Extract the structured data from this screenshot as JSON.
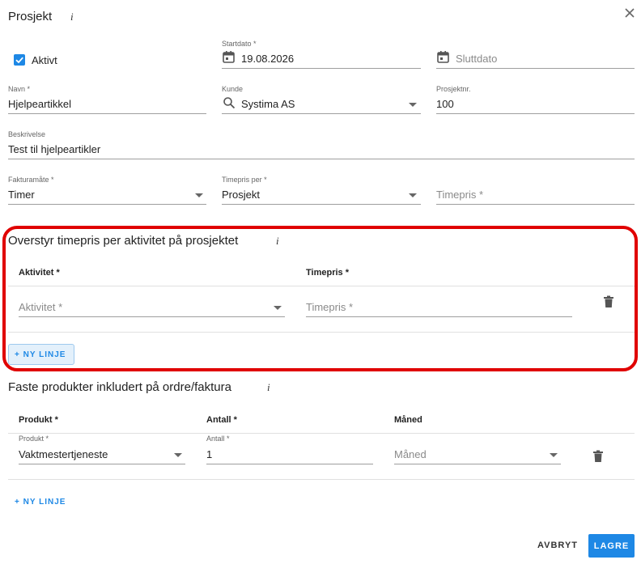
{
  "dialog": {
    "title": "Prosjekt",
    "info": "i"
  },
  "active": {
    "label": "Aktivt",
    "checked": true
  },
  "start_date": {
    "label": "Startdato *",
    "value": "19.08.2026"
  },
  "end_date": {
    "placeholder": "Sluttdato"
  },
  "name": {
    "label": "Navn *",
    "value": "Hjelpeartikkel"
  },
  "customer": {
    "label": "Kunde",
    "value": "Systima AS"
  },
  "project_no": {
    "label": "Prosjektnr.",
    "value": "100"
  },
  "description": {
    "label": "Beskrivelse",
    "value": "Test til hjelpeartikler"
  },
  "billing_method": {
    "label": "Fakturamåte *",
    "value": "Timer"
  },
  "hourly_rate_per": {
    "label": "Timepris per *",
    "value": "Prosjekt"
  },
  "hourly_rate": {
    "placeholder": "Timepris *"
  },
  "override_section": {
    "title": "Overstyr timepris per aktivitet på prosjektet",
    "info": "i",
    "columns": [
      "Aktivitet *",
      "Timepris *"
    ],
    "row": {
      "activity_placeholder": "Aktivitet *",
      "rate_placeholder": "Timepris *"
    },
    "new_line": "+ NY LINJE"
  },
  "products_section": {
    "title": "Faste produkter inkludert på ordre/faktura",
    "info": "i",
    "columns": [
      "Produkt *",
      "Antall *",
      "Måned"
    ],
    "row": {
      "product_label": "Produkt *",
      "product_value": "Vaktmestertjeneste",
      "quantity_label": "Antall *",
      "quantity_value": "1",
      "month_placeholder": "Måned"
    },
    "new_line": "+ NY LINJE"
  },
  "actions": {
    "cancel": "AVBRYT",
    "save": "LAGRE"
  },
  "colors": {
    "accent": "#1e88e5",
    "highlight": "#e00000"
  }
}
